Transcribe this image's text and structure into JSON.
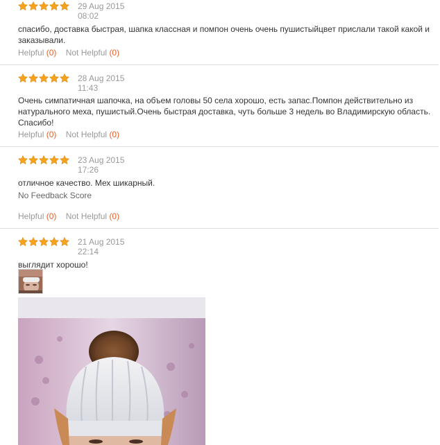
{
  "star_color": "#f7a21b",
  "labels": {
    "helpful": "Helpful",
    "not_helpful": "Not Helpful"
  },
  "reviews": [
    {
      "rating": 5,
      "date": "29 Aug 2015",
      "time": "08:02",
      "text": "спасибо, доставка быстрая, шапка классная и помпон очень очень пушистыйцвет прислали такой какой и заказывали.",
      "helpful_count": "(0)",
      "not_helpful_count": "(0)"
    },
    {
      "rating": 5,
      "date": "28 Aug 2015",
      "time": "11:43",
      "text": "Очень симпатичная шапочка, на объем головы 50 села хорошо, есть запас.Помпон действительно из натурального меха, пушистый.Очень быстрая доставка, чуть больше 3 недель во Владимирскую область. Спасибо!",
      "helpful_count": "(0)",
      "not_helpful_count": "(0)"
    },
    {
      "rating": 5,
      "date": "23 Aug 2015",
      "time": "17:26",
      "text": "отличное качество. Мех шикарный.",
      "feedback_score": "No Feedback Score",
      "helpful_count": "(0)",
      "not_helpful_count": "(0)"
    },
    {
      "rating": 5,
      "date": "21 Aug 2015",
      "time": "22:14",
      "text": "выглядит хорошо!"
    }
  ]
}
